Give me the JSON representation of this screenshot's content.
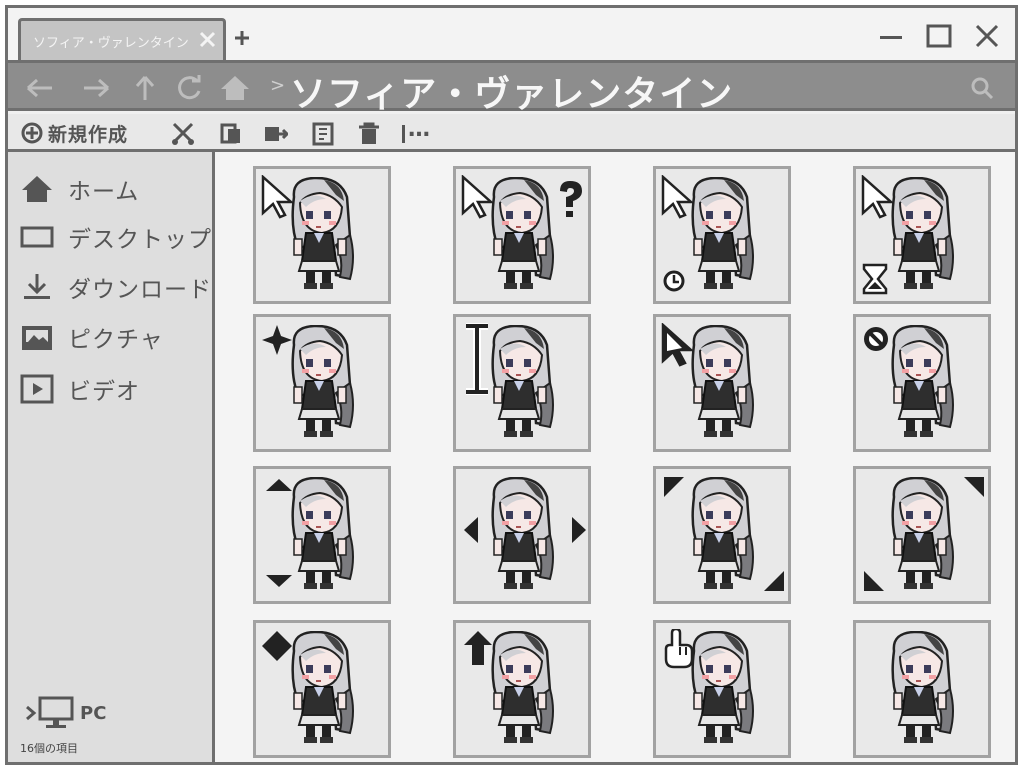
{
  "window": {
    "tab_label": "ソフィア・ヴァレンタイン",
    "path_title": "ソフィア・ヴァレンタイン",
    "path_separator": ">"
  },
  "toolbar": {
    "new_label": "新規作成",
    "more_label": "…"
  },
  "sidebar": {
    "items": [
      {
        "label": "ホーム",
        "icon": "home-icon"
      },
      {
        "label": "デスクトップ",
        "icon": "desktop-icon"
      },
      {
        "label": "ダウンロード",
        "icon": "download-icon"
      },
      {
        "label": "ピクチャ",
        "icon": "pictures-icon"
      },
      {
        "label": "ビデオ",
        "icon": "video-icon"
      }
    ],
    "pc_label": "PC",
    "status": "16個の項目"
  },
  "files": [
    {
      "cursor": "arrow"
    },
    {
      "cursor": "help"
    },
    {
      "cursor": "working"
    },
    {
      "cursor": "busy"
    },
    {
      "cursor": "precision"
    },
    {
      "cursor": "text"
    },
    {
      "cursor": "alternate"
    },
    {
      "cursor": "unavailable"
    },
    {
      "cursor": "vertical-resize"
    },
    {
      "cursor": "horizontal-resize"
    },
    {
      "cursor": "diagonal-resize-1"
    },
    {
      "cursor": "diagonal-resize-2"
    },
    {
      "cursor": "move"
    },
    {
      "cursor": "up-arrow"
    },
    {
      "cursor": "link"
    },
    {
      "cursor": "none"
    }
  ]
}
